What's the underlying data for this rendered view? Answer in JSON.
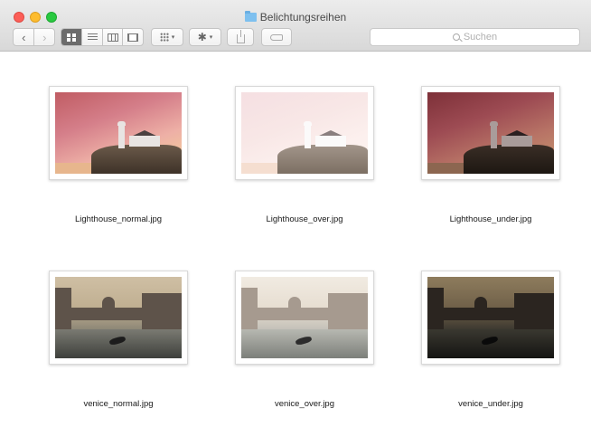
{
  "window": {
    "title": "Belichtungsreihen",
    "title_icon": "folder-icon"
  },
  "toolbar": {
    "back_glyph": "‹",
    "forward_glyph": "›",
    "view_modes": [
      "icon-view",
      "list-view",
      "column-view",
      "cover-flow-view"
    ],
    "active_view": "icon-view",
    "arrange_icon": "arrange-grid-icon",
    "action_icon": "gear-icon",
    "share_icon": "share-icon",
    "tags_icon": "tag-icon",
    "caret_glyph": "▾",
    "gear_glyph": "✱"
  },
  "search": {
    "placeholder": "Suchen"
  },
  "files": [
    {
      "name": "Lighthouse_normal.jpg"
    },
    {
      "name": "Lighthouse_over.jpg"
    },
    {
      "name": "Lighthouse_under.jpg"
    },
    {
      "name": "venice_normal.jpg"
    },
    {
      "name": "venice_over.jpg"
    },
    {
      "name": "venice_under.jpg"
    }
  ]
}
